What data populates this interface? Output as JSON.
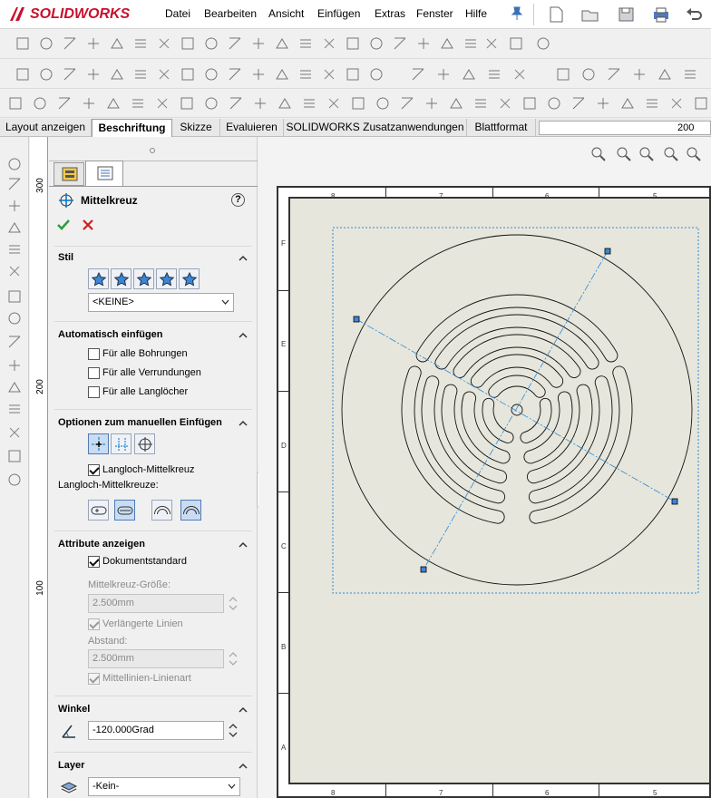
{
  "app": {
    "title": "SOLIDWORKS"
  },
  "menu": [
    "Datei",
    "Bearbeiten",
    "Ansicht",
    "Einfügen",
    "Extras",
    "Fenster",
    "Hilfe"
  ],
  "tabs": [
    "Layout anzeigen",
    "Beschriftung",
    "Skizze",
    "Evaluieren",
    "SOLIDWORKS Zusatzanwendungen",
    "Blattformat"
  ],
  "active_tab": "Beschriftung",
  "ruler_top": {
    "value": "200"
  },
  "ruler_left": {
    "labels": [
      "300",
      "200",
      "100"
    ]
  },
  "panel": {
    "title": "Mittelkreuz",
    "help": "?",
    "sections": {
      "stil": {
        "title": "Stil",
        "select": "<KEINE>"
      },
      "auto": {
        "title": "Automatisch einfügen",
        "items": [
          "Für alle Bohrungen",
          "Für alle Verrundungen",
          "Für alle Langlöcher"
        ]
      },
      "manual": {
        "title": "Optionen zum manuellen Einfügen",
        "check": "Langloch-Mittelkreuz",
        "sub": "Langloch-Mittelkreuze:"
      },
      "attr": {
        "title": "Attribute anzeigen",
        "doc_std": "Dokumentstandard",
        "size_label": "Mittelkreuz-Größe:",
        "size_value": "2.500mm",
        "ext_lines": "Verlängerte Linien",
        "gap_label": "Abstand:",
        "gap_value": "2.500mm",
        "cl_linetype": "Mittellinien-Linienart"
      },
      "winkel": {
        "title": "Winkel",
        "value": "-120.000Grad"
      },
      "layer": {
        "title": "Layer",
        "select": "-Kein-"
      }
    }
  },
  "sheet": {
    "zones_top": [
      "8",
      "7",
      "6",
      "5"
    ],
    "zones_left": [
      "F",
      "E",
      "D",
      "C",
      "B",
      "A"
    ]
  },
  "colors": {
    "accent": "#0072c6",
    "check_green": "#2e9c3a",
    "cross_red": "#cc1f1f",
    "logo_red": "#c8102e"
  }
}
